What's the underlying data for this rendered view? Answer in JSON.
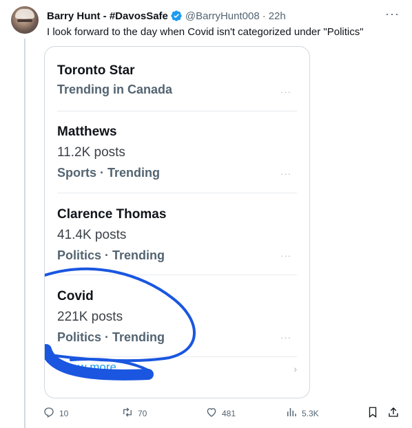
{
  "tweet": {
    "author_name": "Barry Hunt - #DavosSafe",
    "handle": "@BarryHunt008",
    "separator": "·",
    "time": "22h",
    "more": "···",
    "text": "I look forward to the day when Covid isn't categorized under \"Politics\""
  },
  "card": {
    "trends": [
      {
        "title": "Toronto Star",
        "posts": "",
        "category": "Trending in Canada",
        "more": "···"
      },
      {
        "title": "Matthews",
        "posts": "11.2K posts",
        "category": "Sports · Trending",
        "more": "···"
      },
      {
        "title": "Clarence Thomas",
        "posts": "41.4K posts",
        "category": "Politics · Trending",
        "more": "···"
      },
      {
        "title": "Covid",
        "posts": "221K posts",
        "category": "Politics · Trending",
        "more": "···"
      }
    ],
    "show_more": "Show more",
    "chevron": "›"
  },
  "actions": {
    "replies": "10",
    "reposts": "70",
    "likes": "481",
    "views": "5.3K"
  },
  "icons": {
    "verified": "verified-badge-icon",
    "reply": "reply-icon",
    "repost": "repost-icon",
    "like": "heart-icon",
    "views": "views-icon",
    "bookmark": "bookmark-icon",
    "share": "share-icon"
  },
  "colors": {
    "accent": "#1d9bf0",
    "scribble": "#1a56e0",
    "secondary_text": "#536471"
  }
}
